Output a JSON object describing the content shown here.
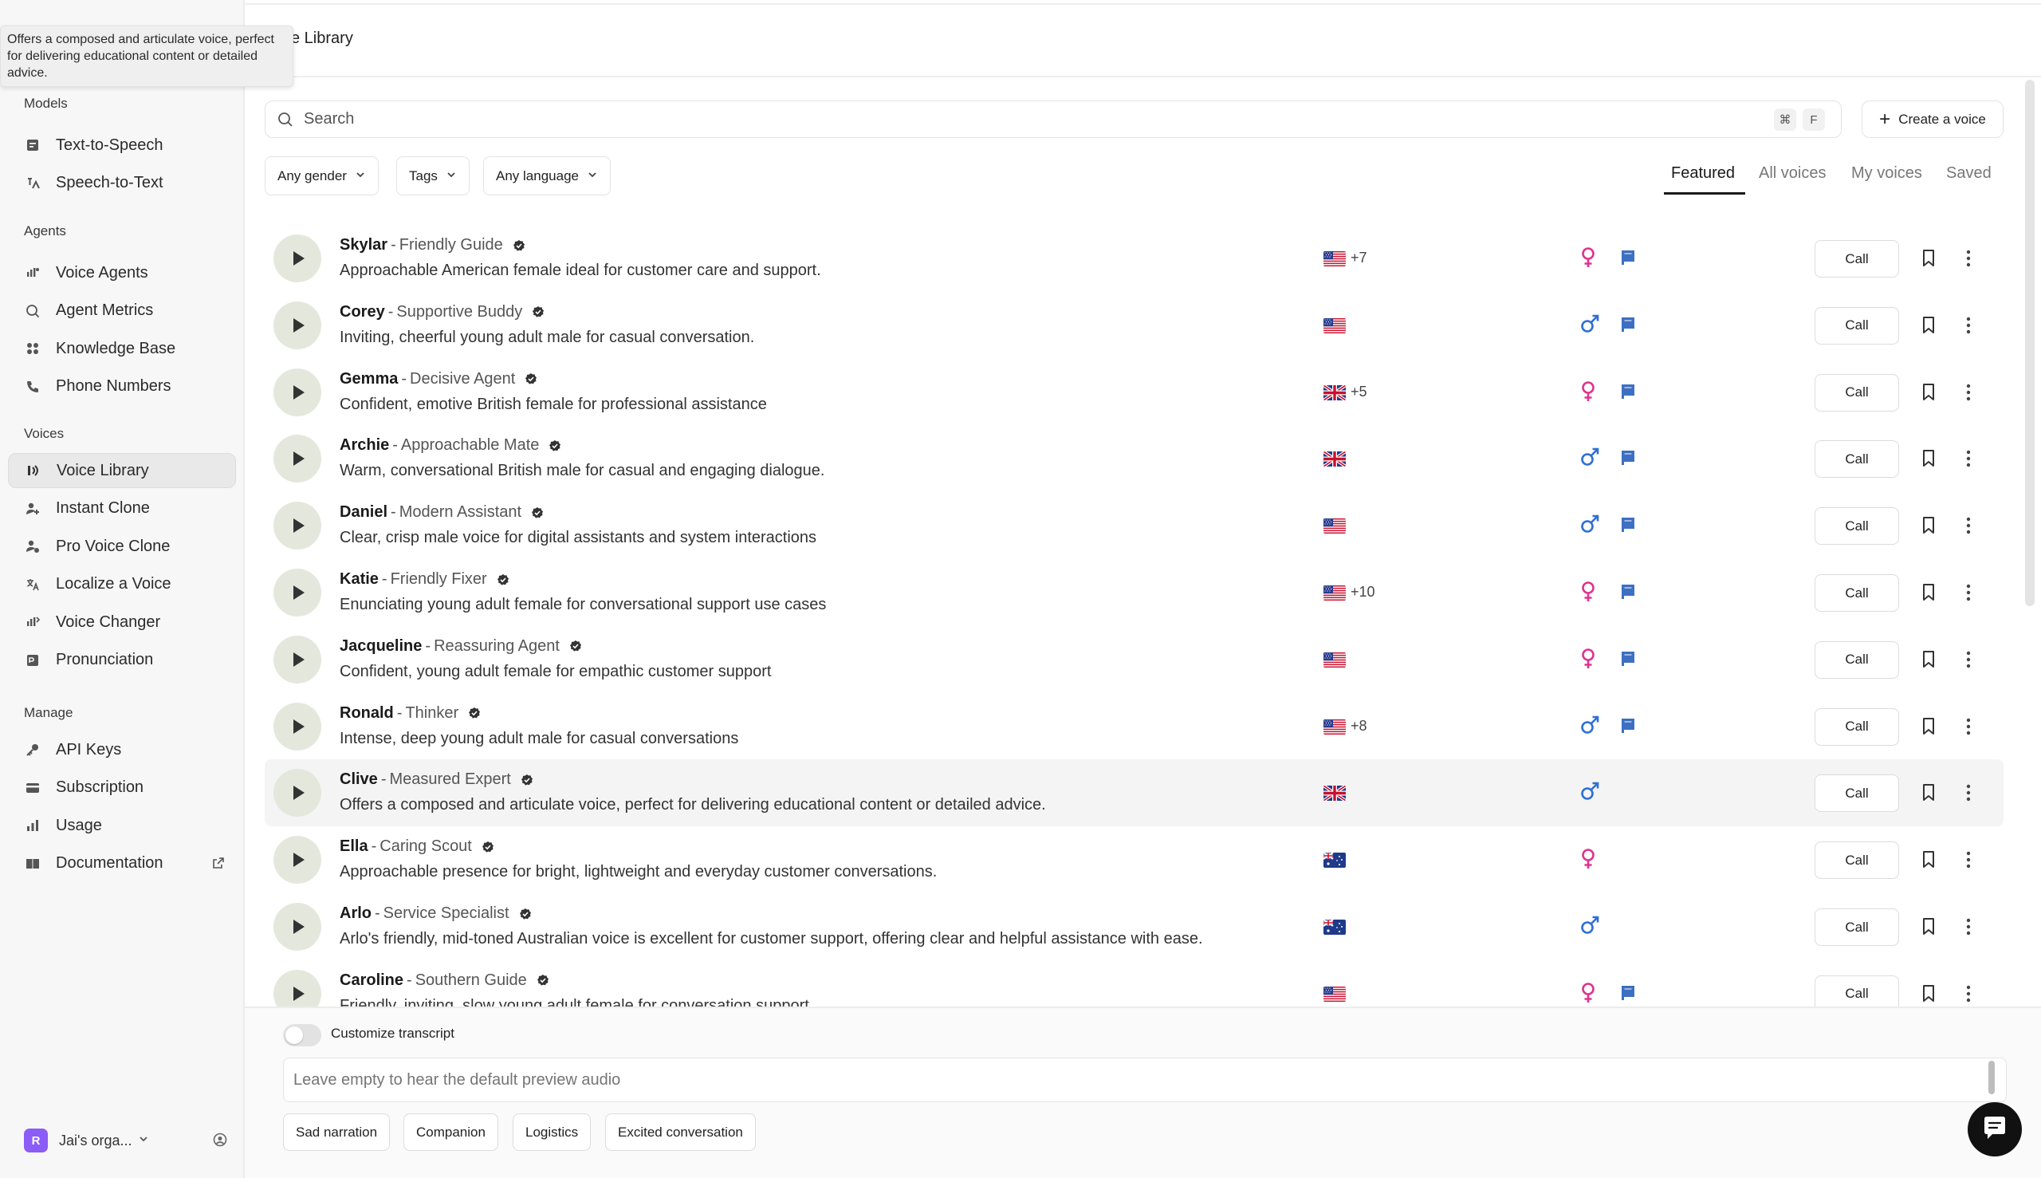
{
  "tooltip": "Offers a composed and articulate voice, perfect for delivering educational content or detailed advice.",
  "sidebar": {
    "sections": [
      {
        "title": "Models",
        "items": [
          {
            "label": "Text-to-Speech",
            "icon": "tts-icon"
          },
          {
            "label": "Speech-to-Text",
            "icon": "stt-icon"
          }
        ]
      },
      {
        "title": "Agents",
        "items": [
          {
            "label": "Voice Agents",
            "icon": "voice-agents-icon"
          },
          {
            "label": "Agent Metrics",
            "icon": "metrics-icon"
          },
          {
            "label": "Knowledge Base",
            "icon": "knowledge-icon"
          },
          {
            "label": "Phone Numbers",
            "icon": "phone-icon"
          }
        ]
      },
      {
        "title": "Voices",
        "items": [
          {
            "label": "Voice Library",
            "icon": "voice-library-icon",
            "active": true
          },
          {
            "label": "Instant Clone",
            "icon": "instant-clone-icon"
          },
          {
            "label": "Pro Voice Clone",
            "icon": "pro-clone-icon"
          },
          {
            "label": "Localize a Voice",
            "icon": "localize-icon"
          },
          {
            "label": "Voice Changer",
            "icon": "voice-changer-icon"
          },
          {
            "label": "Pronunciation",
            "icon": "pronunciation-icon"
          }
        ]
      },
      {
        "title": "Manage",
        "items": [
          {
            "label": "API Keys",
            "icon": "key-icon"
          },
          {
            "label": "Subscription",
            "icon": "card-icon"
          },
          {
            "label": "Usage",
            "icon": "chart-icon"
          },
          {
            "label": "Documentation",
            "icon": "book-icon",
            "external": true
          }
        ]
      }
    ],
    "org": {
      "avatar": "R",
      "name": "Jai's orga..."
    }
  },
  "header": {
    "title": "ce Library"
  },
  "search": {
    "placeholder": "Search",
    "shortcut": [
      "⌘",
      "F"
    ]
  },
  "create_label": "Create a voice",
  "filters": [
    "Any gender",
    "Tags",
    "Any language"
  ],
  "tabs": [
    "Featured",
    "All voices",
    "My voices",
    "Saved"
  ],
  "active_tab": "Featured",
  "call_label": "Call",
  "voices": [
    {
      "name": "Skylar",
      "role": "Friendly Guide",
      "desc": "Approachable American female ideal for customer care and support.",
      "flag": "us",
      "extra": "+7",
      "gender": "female",
      "badge": true
    },
    {
      "name": "Corey",
      "role": "Supportive Buddy",
      "desc": "Inviting, cheerful young adult male for casual conversation.",
      "flag": "us",
      "extra": "",
      "gender": "male",
      "badge": true
    },
    {
      "name": "Gemma",
      "role": "Decisive Agent",
      "desc": "Confident, emotive British female for professional assistance",
      "flag": "gb",
      "extra": "+5",
      "gender": "female",
      "badge": true
    },
    {
      "name": "Archie",
      "role": "Approachable Mate",
      "desc": "Warm, conversational British male for casual and engaging dialogue.",
      "flag": "gb",
      "extra": "",
      "gender": "male",
      "badge": true
    },
    {
      "name": "Daniel",
      "role": "Modern Assistant",
      "desc": "Clear, crisp male voice for digital assistants and system interactions",
      "flag": "us",
      "extra": "",
      "gender": "male",
      "badge": true
    },
    {
      "name": "Katie",
      "role": "Friendly Fixer",
      "desc": "Enunciating young adult female for conversational support use cases",
      "flag": "us",
      "extra": "+10",
      "gender": "female",
      "badge": true
    },
    {
      "name": "Jacqueline",
      "role": "Reassuring Agent",
      "desc": "Confident, young adult female for empathic customer support",
      "flag": "us",
      "extra": "",
      "gender": "female",
      "badge": true
    },
    {
      "name": "Ronald",
      "role": "Thinker",
      "desc": "Intense, deep young adult male for casual conversations",
      "flag": "us",
      "extra": "+8",
      "gender": "male",
      "badge": true
    },
    {
      "name": "Clive",
      "role": "Measured Expert",
      "desc": "Offers a composed and articulate voice, perfect for delivering educational content or detailed advice.",
      "flag": "gb",
      "extra": "",
      "gender": "male",
      "badge": false,
      "hover": true
    },
    {
      "name": "Ella",
      "role": "Caring Scout",
      "desc": "Approachable presence for bright, lightweight and everyday customer conversations.",
      "flag": "au",
      "extra": "",
      "gender": "female",
      "badge": false
    },
    {
      "name": "Arlo",
      "role": "Service Specialist",
      "desc": "Arlo's friendly, mid-toned Australian voice is excellent for customer support, offering clear and helpful assistance with ease.",
      "flag": "au",
      "extra": "",
      "gender": "male",
      "badge": false
    },
    {
      "name": "Caroline",
      "role": "Southern Guide",
      "desc": "Friendly, inviting, slow young adult female for conversation support",
      "flag": "us",
      "extra": "",
      "gender": "female",
      "badge": true
    }
  ],
  "bottom": {
    "toggle_label": "Customize transcript",
    "preview_placeholder": "Leave empty to hear the default preview audio",
    "chips": [
      "Sad narration",
      "Companion",
      "Logistics",
      "Excited conversation"
    ]
  },
  "colors": {
    "female": "#e0338f",
    "male": "#2f6fd6",
    "badge": "#3d6fc2",
    "active_bg": "#e9e9e9"
  }
}
